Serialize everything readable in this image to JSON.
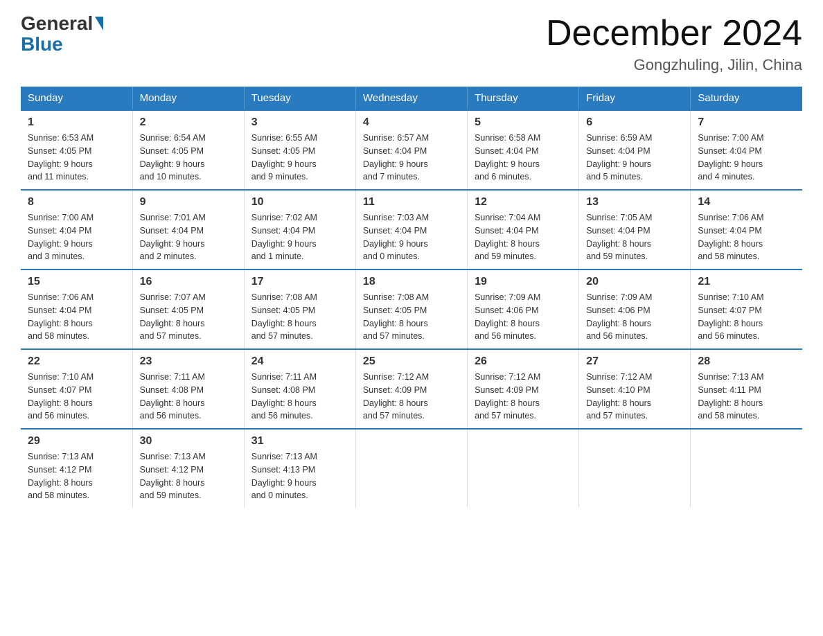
{
  "logo": {
    "general_text": "General",
    "blue_text": "Blue"
  },
  "header": {
    "title": "December 2024",
    "location": "Gongzhuling, Jilin, China"
  },
  "days_of_week": [
    "Sunday",
    "Monday",
    "Tuesday",
    "Wednesday",
    "Thursday",
    "Friday",
    "Saturday"
  ],
  "weeks": [
    [
      {
        "day": "1",
        "sunrise": "6:53 AM",
        "sunset": "4:05 PM",
        "daylight": "9 hours and 11 minutes."
      },
      {
        "day": "2",
        "sunrise": "6:54 AM",
        "sunset": "4:05 PM",
        "daylight": "9 hours and 10 minutes."
      },
      {
        "day": "3",
        "sunrise": "6:55 AM",
        "sunset": "4:05 PM",
        "daylight": "9 hours and 9 minutes."
      },
      {
        "day": "4",
        "sunrise": "6:57 AM",
        "sunset": "4:04 PM",
        "daylight": "9 hours and 7 minutes."
      },
      {
        "day": "5",
        "sunrise": "6:58 AM",
        "sunset": "4:04 PM",
        "daylight": "9 hours and 6 minutes."
      },
      {
        "day": "6",
        "sunrise": "6:59 AM",
        "sunset": "4:04 PM",
        "daylight": "9 hours and 5 minutes."
      },
      {
        "day": "7",
        "sunrise": "7:00 AM",
        "sunset": "4:04 PM",
        "daylight": "9 hours and 4 minutes."
      }
    ],
    [
      {
        "day": "8",
        "sunrise": "7:00 AM",
        "sunset": "4:04 PM",
        "daylight": "9 hours and 3 minutes."
      },
      {
        "day": "9",
        "sunrise": "7:01 AM",
        "sunset": "4:04 PM",
        "daylight": "9 hours and 2 minutes."
      },
      {
        "day": "10",
        "sunrise": "7:02 AM",
        "sunset": "4:04 PM",
        "daylight": "9 hours and 1 minute."
      },
      {
        "day": "11",
        "sunrise": "7:03 AM",
        "sunset": "4:04 PM",
        "daylight": "9 hours and 0 minutes."
      },
      {
        "day": "12",
        "sunrise": "7:04 AM",
        "sunset": "4:04 PM",
        "daylight": "8 hours and 59 minutes."
      },
      {
        "day": "13",
        "sunrise": "7:05 AM",
        "sunset": "4:04 PM",
        "daylight": "8 hours and 59 minutes."
      },
      {
        "day": "14",
        "sunrise": "7:06 AM",
        "sunset": "4:04 PM",
        "daylight": "8 hours and 58 minutes."
      }
    ],
    [
      {
        "day": "15",
        "sunrise": "7:06 AM",
        "sunset": "4:04 PM",
        "daylight": "8 hours and 58 minutes."
      },
      {
        "day": "16",
        "sunrise": "7:07 AM",
        "sunset": "4:05 PM",
        "daylight": "8 hours and 57 minutes."
      },
      {
        "day": "17",
        "sunrise": "7:08 AM",
        "sunset": "4:05 PM",
        "daylight": "8 hours and 57 minutes."
      },
      {
        "day": "18",
        "sunrise": "7:08 AM",
        "sunset": "4:05 PM",
        "daylight": "8 hours and 57 minutes."
      },
      {
        "day": "19",
        "sunrise": "7:09 AM",
        "sunset": "4:06 PM",
        "daylight": "8 hours and 56 minutes."
      },
      {
        "day": "20",
        "sunrise": "7:09 AM",
        "sunset": "4:06 PM",
        "daylight": "8 hours and 56 minutes."
      },
      {
        "day": "21",
        "sunrise": "7:10 AM",
        "sunset": "4:07 PM",
        "daylight": "8 hours and 56 minutes."
      }
    ],
    [
      {
        "day": "22",
        "sunrise": "7:10 AM",
        "sunset": "4:07 PM",
        "daylight": "8 hours and 56 minutes."
      },
      {
        "day": "23",
        "sunrise": "7:11 AM",
        "sunset": "4:08 PM",
        "daylight": "8 hours and 56 minutes."
      },
      {
        "day": "24",
        "sunrise": "7:11 AM",
        "sunset": "4:08 PM",
        "daylight": "8 hours and 56 minutes."
      },
      {
        "day": "25",
        "sunrise": "7:12 AM",
        "sunset": "4:09 PM",
        "daylight": "8 hours and 57 minutes."
      },
      {
        "day": "26",
        "sunrise": "7:12 AM",
        "sunset": "4:09 PM",
        "daylight": "8 hours and 57 minutes."
      },
      {
        "day": "27",
        "sunrise": "7:12 AM",
        "sunset": "4:10 PM",
        "daylight": "8 hours and 57 minutes."
      },
      {
        "day": "28",
        "sunrise": "7:13 AM",
        "sunset": "4:11 PM",
        "daylight": "8 hours and 58 minutes."
      }
    ],
    [
      {
        "day": "29",
        "sunrise": "7:13 AM",
        "sunset": "4:12 PM",
        "daylight": "8 hours and 58 minutes."
      },
      {
        "day": "30",
        "sunrise": "7:13 AM",
        "sunset": "4:12 PM",
        "daylight": "8 hours and 59 minutes."
      },
      {
        "day": "31",
        "sunrise": "7:13 AM",
        "sunset": "4:13 PM",
        "daylight": "9 hours and 0 minutes."
      },
      null,
      null,
      null,
      null
    ]
  ],
  "labels": {
    "sunrise": "Sunrise:",
    "sunset": "Sunset:",
    "daylight": "Daylight:"
  }
}
